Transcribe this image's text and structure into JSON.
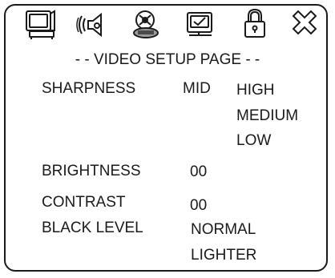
{
  "toolbar": {
    "icons": [
      {
        "name": "general-setup-icon"
      },
      {
        "name": "audio-setup-icon"
      },
      {
        "name": "dolby-setup-icon"
      },
      {
        "name": "video-setup-icon"
      },
      {
        "name": "lock-icon"
      },
      {
        "name": "exit-icon"
      }
    ]
  },
  "page": {
    "title": "- - VIDEO SETUP PAGE - -"
  },
  "settings": {
    "sharpness": {
      "label": "SHARPNESS",
      "current": "MID",
      "options": [
        "HIGH",
        "MEDIUM",
        "LOW"
      ]
    },
    "brightness": {
      "label": "BRIGHTNESS",
      "value": "00"
    },
    "contrast": {
      "label": "CONTRAST",
      "value": "00"
    },
    "black_level": {
      "label": "BLACK LEVEL",
      "options": [
        "NORMAL",
        "LIGHTER"
      ]
    }
  }
}
